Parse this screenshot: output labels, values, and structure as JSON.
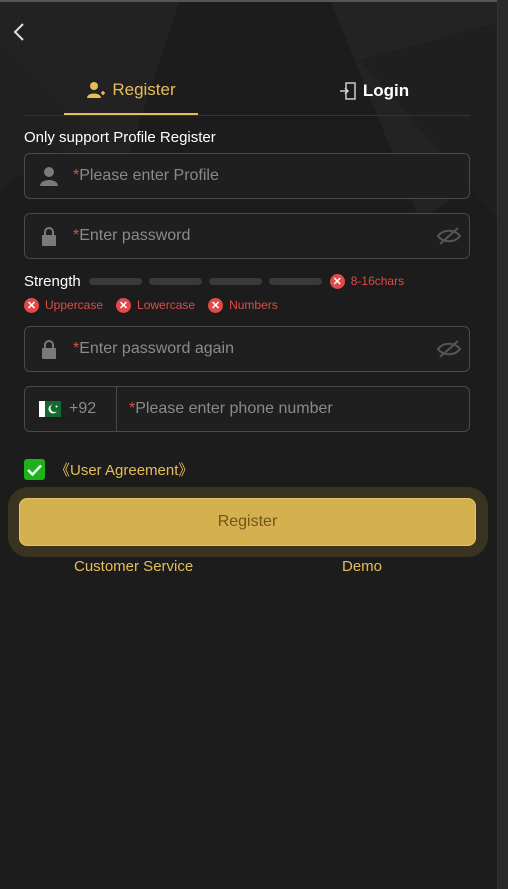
{
  "tabs": {
    "register": "Register",
    "login": "Login"
  },
  "hint": "Only support Profile Register",
  "fields": {
    "profile": {
      "required": "*",
      "placeholder": "Please enter Profile"
    },
    "password": {
      "required": "*",
      "placeholder": "Enter password"
    },
    "password_again": {
      "required": "*",
      "placeholder": "Enter password again"
    },
    "phone": {
      "country_code": "+92",
      "required": "*",
      "placeholder": "Please enter phone number"
    }
  },
  "strength": {
    "label": "Strength",
    "length_rule": "8-16chars",
    "rules": [
      "Uppercase",
      "Lowercase",
      "Numbers"
    ]
  },
  "agreement": "《User Agreement》",
  "register_button": "Register",
  "links": {
    "customer_service": "Customer Service",
    "demo": "Demo"
  },
  "colors": {
    "accent": "#e7bd58",
    "button": "#d4b04f",
    "error": "#e04a4a",
    "check": "#1db21d",
    "background": "#1c1c1c"
  }
}
